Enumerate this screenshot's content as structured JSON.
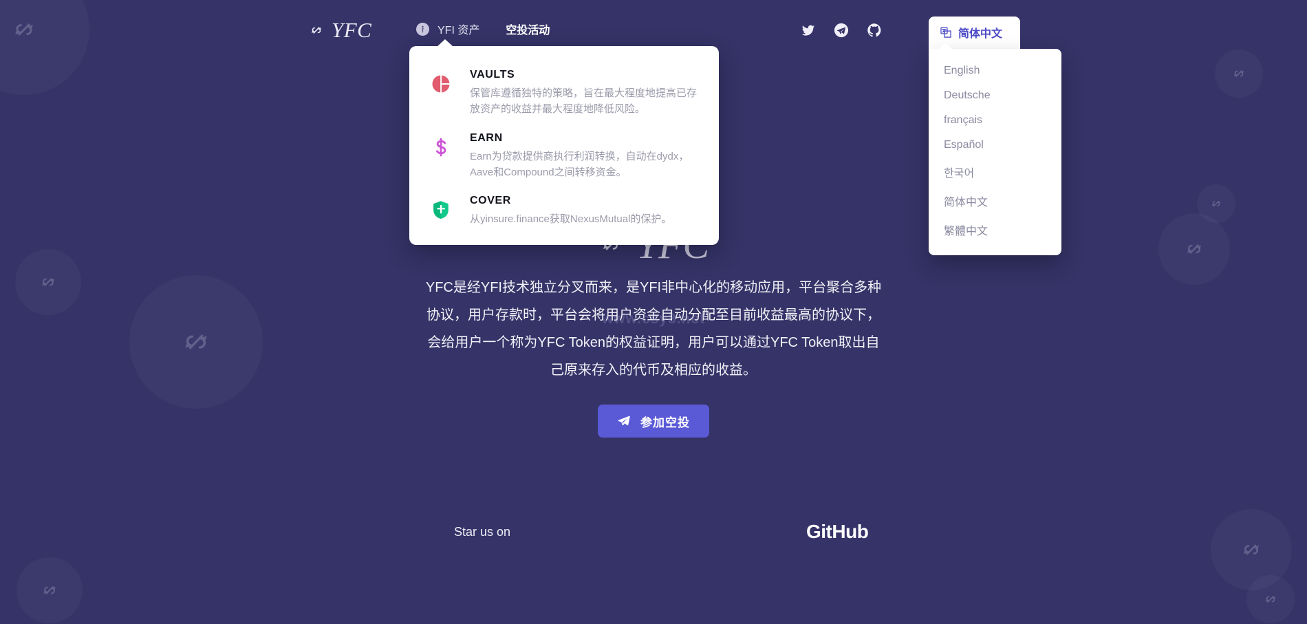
{
  "theme": {
    "background": "#353367",
    "accent": "#5a59d6",
    "lang_accent": "#4b49c6",
    "card_background": "#ffffff",
    "vault_icon_color": "#e05c6e",
    "earn_icon_color": "#cc55d6",
    "cover_icon_color": "#11c98a"
  },
  "header": {
    "brand": {
      "label": "YFC",
      "icon": "chain-link-icon"
    },
    "nav": [
      {
        "label": "YFI 资产",
        "icon": "info-circle-icon",
        "active": true
      },
      {
        "label": "空投活动",
        "icon": null,
        "active": false
      }
    ],
    "social": [
      {
        "name": "twitter-icon"
      },
      {
        "name": "telegram-icon"
      },
      {
        "name": "github-icon"
      }
    ]
  },
  "products_menu": {
    "items": [
      {
        "title": "VAULTS",
        "icon": "vault-pie-icon",
        "description": "保管库遵循独特的策略，旨在最大程度地提高已存放资产的收益并最大程度地降低风险。"
      },
      {
        "title": "EARN",
        "icon": "dollar-sign-icon",
        "description": "Earn为贷款提供商执行利润转换，自动在dydx，Aave和Compound之间转移资金。"
      },
      {
        "title": "COVER",
        "icon": "shield-icon",
        "description": "从yinsure.finance获取NexusMutual的保护。"
      }
    ]
  },
  "language_selector": {
    "icon": "language-globe-icon",
    "selected": "简体中文",
    "options": [
      "English",
      "Deutsche",
      "français",
      "Español",
      "한국어",
      "简体中文",
      "繁體中文"
    ]
  },
  "hero": {
    "logo_text": "YFC",
    "logo_icon": "chain-link-icon",
    "description": "YFC是经YFI技术独立分叉而来，是YFI非中心化的移动应用，平台聚合多种协议，用户存款时，平台会将用户资金自动分配至目前收益最高的协议下，会给用户一个称为YFC Token的权益证明，用户可以通过YFC Token取出自己原来存入的代币及相应的收益。",
    "watermark": "www.csy8.net",
    "cta": {
      "label": "参加空投",
      "icon": "paper-plane-icon"
    }
  },
  "footer": {
    "star_text": "Star us on",
    "github_label": "GitHub"
  }
}
